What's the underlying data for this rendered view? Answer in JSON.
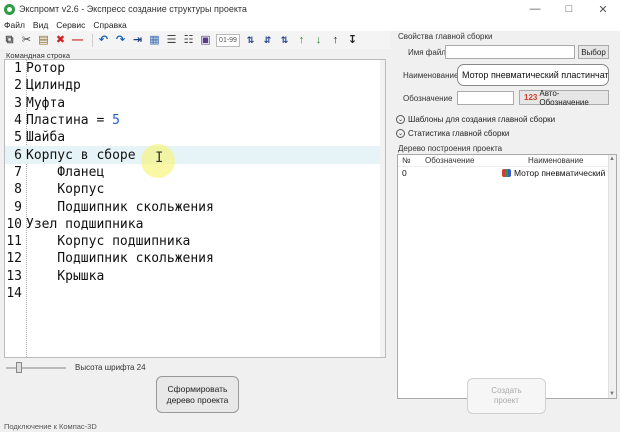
{
  "window": {
    "title": "Экспромт v2.6 - Экспресс создание структуры проекта"
  },
  "menu": [
    "Файл",
    "Вид",
    "Сервис",
    "Справка"
  ],
  "toolbar": {
    "counter_label": "01-99"
  },
  "editor": {
    "label": "Командная строка",
    "lines": [
      {
        "num": "1",
        "text": "Ротор"
      },
      {
        "num": "2",
        "text": "Цилиндр"
      },
      {
        "num": "3",
        "text": "Муфта"
      },
      {
        "num": "4",
        "text": "Пластина = ",
        "value": "5"
      },
      {
        "num": "5",
        "text": "Шайба"
      },
      {
        "num": "6",
        "text": "Корпус в сборе"
      },
      {
        "num": "7",
        "text": "    Фланец"
      },
      {
        "num": "8",
        "text": "    Корпус"
      },
      {
        "num": "9",
        "text": "    Подшипник скольжения"
      },
      {
        "num": "10",
        "text": "Узел подшипника"
      },
      {
        "num": "11",
        "text": "    Корпус подшипника"
      },
      {
        "num": "12",
        "text": "    Подшипник скольжения"
      },
      {
        "num": "13",
        "text": "    Крышка"
      },
      {
        "num": "14",
        "text": ""
      }
    ],
    "active_line": 6
  },
  "font_size_label": "Высота шрифта 24",
  "build_button": {
    "line1": "Сформировать",
    "line2": "дерево проекта"
  },
  "main_assembly": {
    "section_title": "Свойства главной сборки",
    "file_name_label": "Имя файла",
    "file_name_value": "",
    "browse_label": "Выбор",
    "name_label": "Наименование",
    "name_value": "Мотор пневматический пластинчат",
    "designation_label": "Обозначение",
    "designation_value": "",
    "auto_designation_label": "Авто-Обозначение",
    "auto_designation_icon_text": "123"
  },
  "expanders": {
    "templates": "Шаблоны для создания главной сборки",
    "stats": "Статистика главной сборки"
  },
  "tree": {
    "title": "Дерево построения проекта",
    "columns": [
      "№",
      "Обозначение",
      "Наименование"
    ],
    "rows": [
      {
        "no": "0",
        "designation": "",
        "name": "Мотор пневматический"
      }
    ]
  },
  "create_button": {
    "line1": "Создать",
    "line2": "проект"
  },
  "status": "Подключение к Компас-3D"
}
